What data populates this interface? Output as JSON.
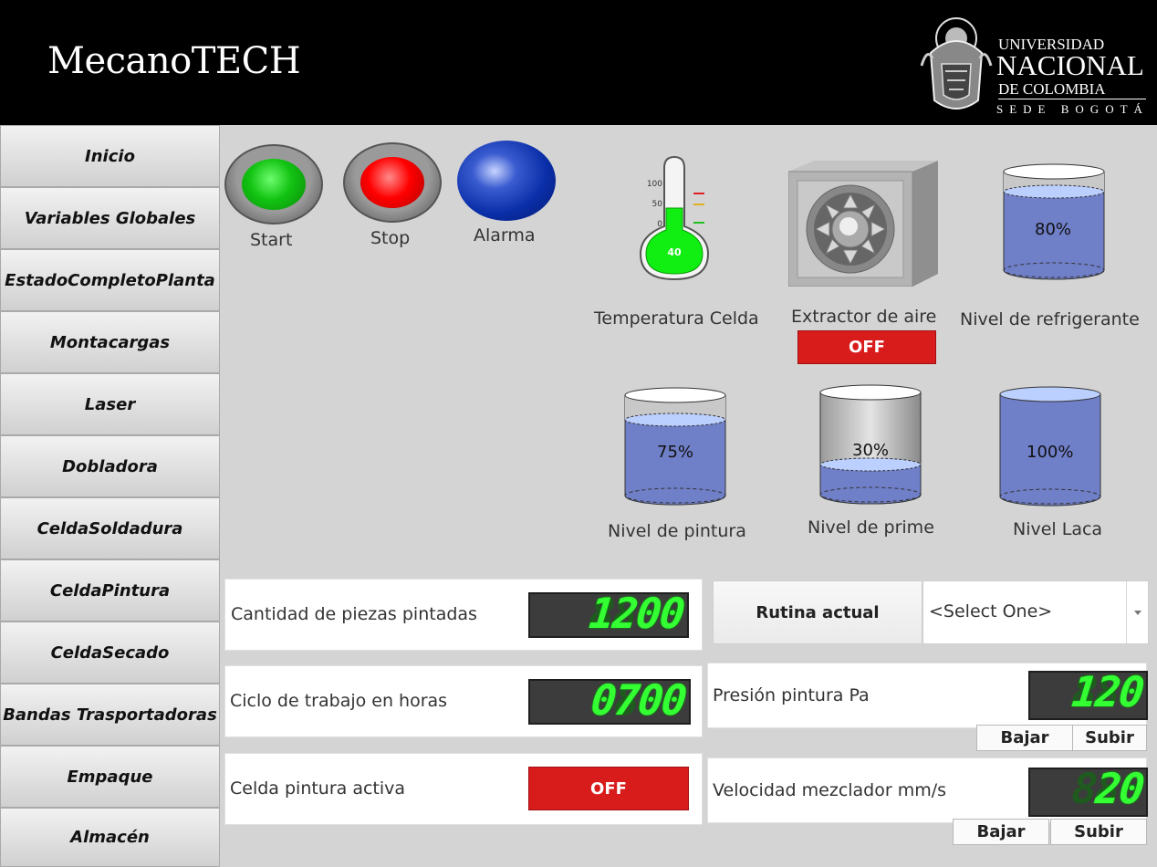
{
  "header": {
    "brand": "MecanoTECH",
    "logo": {
      "line1": "UNIVERSIDAD",
      "line2": "NACIONAL",
      "line3": "DE COLOMBIA",
      "line4": "SEDE BOGOTÁ"
    }
  },
  "sidebar": {
    "items": [
      {
        "label": "Inicio"
      },
      {
        "label": "Variables Globales"
      },
      {
        "label": "EstadoCompletoPlanta"
      },
      {
        "label": "Montacargas"
      },
      {
        "label": "Laser"
      },
      {
        "label": "Dobladora"
      },
      {
        "label": "CeldaSoldadura"
      },
      {
        "label": "CeldaPintura"
      },
      {
        "label": "CeldaSecado"
      },
      {
        "label": "Bandas Trasportadoras"
      },
      {
        "label": "Empaque"
      },
      {
        "label": "Almacén"
      }
    ]
  },
  "controls": {
    "start_label": "Start",
    "stop_label": "Stop",
    "alarm_label": "Alarma",
    "start_color": "#12c312",
    "stop_color": "#ff0000",
    "alarm_color": "#0a2ea8"
  },
  "thermometer": {
    "label": "Temperatura Celda",
    "value": "40",
    "ticks": [
      "100",
      "50",
      "0"
    ],
    "fill_color": "#11ee11"
  },
  "extractor": {
    "label": "Extractor de aire",
    "status": "OFF"
  },
  "tanks": {
    "refrigerante": {
      "label": "Nivel de refrigerante",
      "value_text": "80%",
      "level": 0.8
    },
    "pintura": {
      "label": "Nivel de pintura",
      "value_text": "75%",
      "level": 0.75
    },
    "prime": {
      "label": "Nivel de prime",
      "value_text": "30%",
      "level": 0.3
    },
    "laca": {
      "label": "Nivel Laca",
      "value_text": "100%",
      "level": 1.0
    }
  },
  "panels": {
    "piezas": {
      "label": "Cantidad de piezas pintadas",
      "display": "1200",
      "ghost": "8888"
    },
    "ciclo": {
      "label": "Ciclo de trabajo en horas",
      "display": "0700",
      "ghost": "8888"
    },
    "celda": {
      "label": "Celda pintura  activa",
      "status": "OFF"
    },
    "rutina": {
      "label": "Rutina actual",
      "selected": "<Select One>"
    },
    "presion": {
      "label": "Presión pintura Pa",
      "display": "120",
      "ghost": "888",
      "down_label": "Bajar",
      "up_label": "Subir"
    },
    "velocidad": {
      "label": "Velocidad mezclador mm/s",
      "display": "20",
      "ghost": "888",
      "down_label": "Bajar",
      "up_label": "Subir"
    }
  }
}
